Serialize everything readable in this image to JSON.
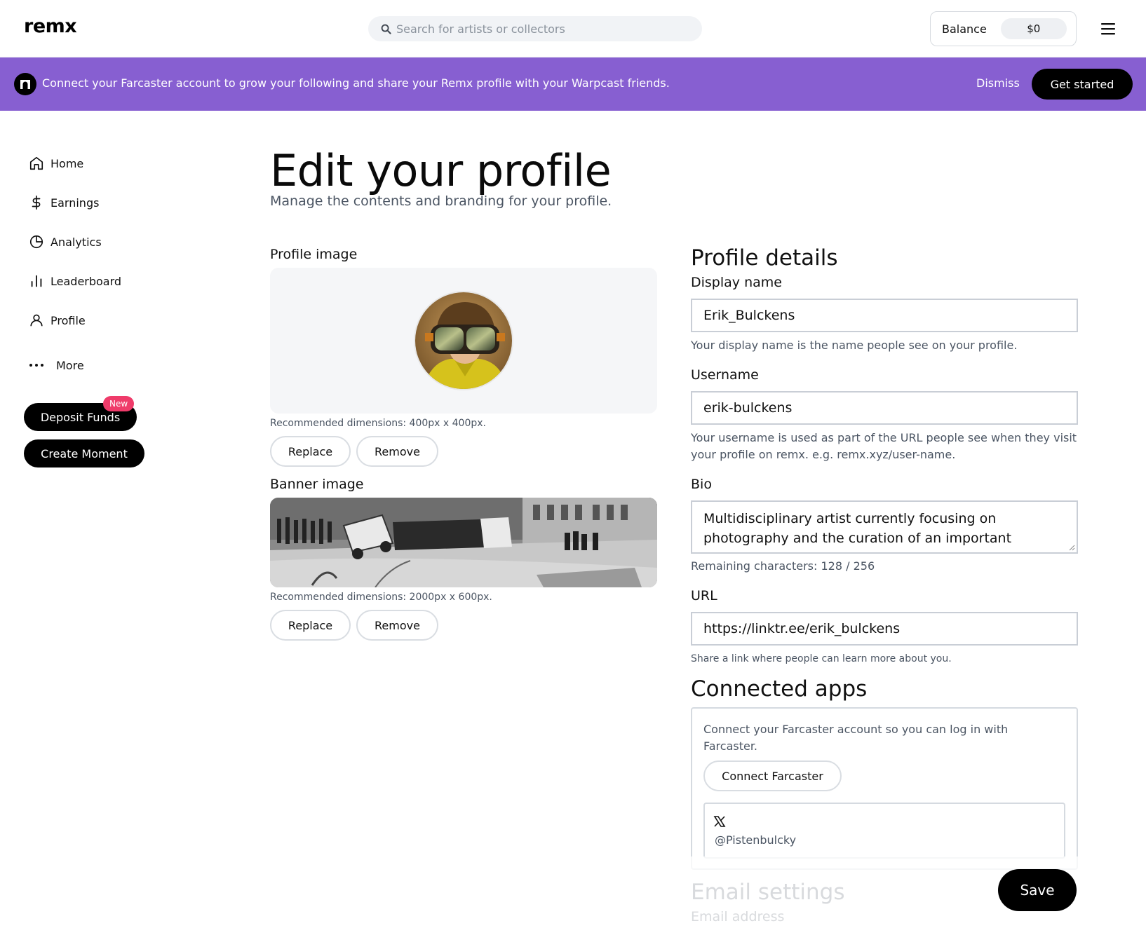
{
  "header": {
    "logo": "remx",
    "search_placeholder": "Search for artists or collectors",
    "balance_label": "Balance",
    "balance_value": "$0"
  },
  "banner": {
    "text": "Connect your Farcaster account to grow your following and share your Remx profile with your Warpcast friends.",
    "dismiss": "Dismiss",
    "cta": "Get started"
  },
  "sidebar": {
    "items": [
      {
        "label": "Home",
        "icon": "home-icon"
      },
      {
        "label": "Earnings",
        "icon": "dollar-icon"
      },
      {
        "label": "Analytics",
        "icon": "pie-chart-icon"
      },
      {
        "label": "Leaderboard",
        "icon": "bar-chart-icon"
      },
      {
        "label": "Profile",
        "icon": "user-icon"
      },
      {
        "label": "More",
        "icon": "more-icon"
      }
    ],
    "deposit": "Deposit Funds",
    "new_badge": "New",
    "create": "Create Moment"
  },
  "main": {
    "title": "Edit your profile",
    "subtitle": "Manage the contents and branding for your profile.",
    "profile_image": {
      "label": "Profile image",
      "hint": "Recommended dimensions: 400px x 400px.",
      "replace": "Replace",
      "remove": "Remove"
    },
    "banner_image": {
      "label": "Banner image",
      "hint": "Recommended dimensions: 2000px x 600px.",
      "replace": "Replace",
      "remove": "Remove"
    }
  },
  "details": {
    "title": "Profile details",
    "display_name_label": "Display name",
    "display_name_value": "Erik_Bulckens",
    "display_name_help": "Your display name is the name people see on your profile.",
    "username_label": "Username",
    "username_value": "erik-bulckens",
    "username_help": "Your username is used as part of the URL people see when they visit your profile on remx. e.g. remx.xyz/user-name.",
    "bio_label": "Bio",
    "bio_value": "Multidisciplinary artist currently focusing on photography and the curation of an important (family) archive",
    "bio_remaining": "Remaining characters: 128 / 256",
    "url_label": "URL",
    "url_value": "https://linktr.ee/erik_bulckens",
    "url_help": "Share a link where people can learn more about you."
  },
  "apps": {
    "title": "Connected apps",
    "farcaster_text": "Connect your Farcaster account so you can log in with Farcaster.",
    "connect_farcaster": "Connect Farcaster",
    "x_handle": "@Pistenbulcky"
  },
  "email": {
    "title": "Email settings",
    "address_label": "Email address"
  },
  "save": "Save"
}
